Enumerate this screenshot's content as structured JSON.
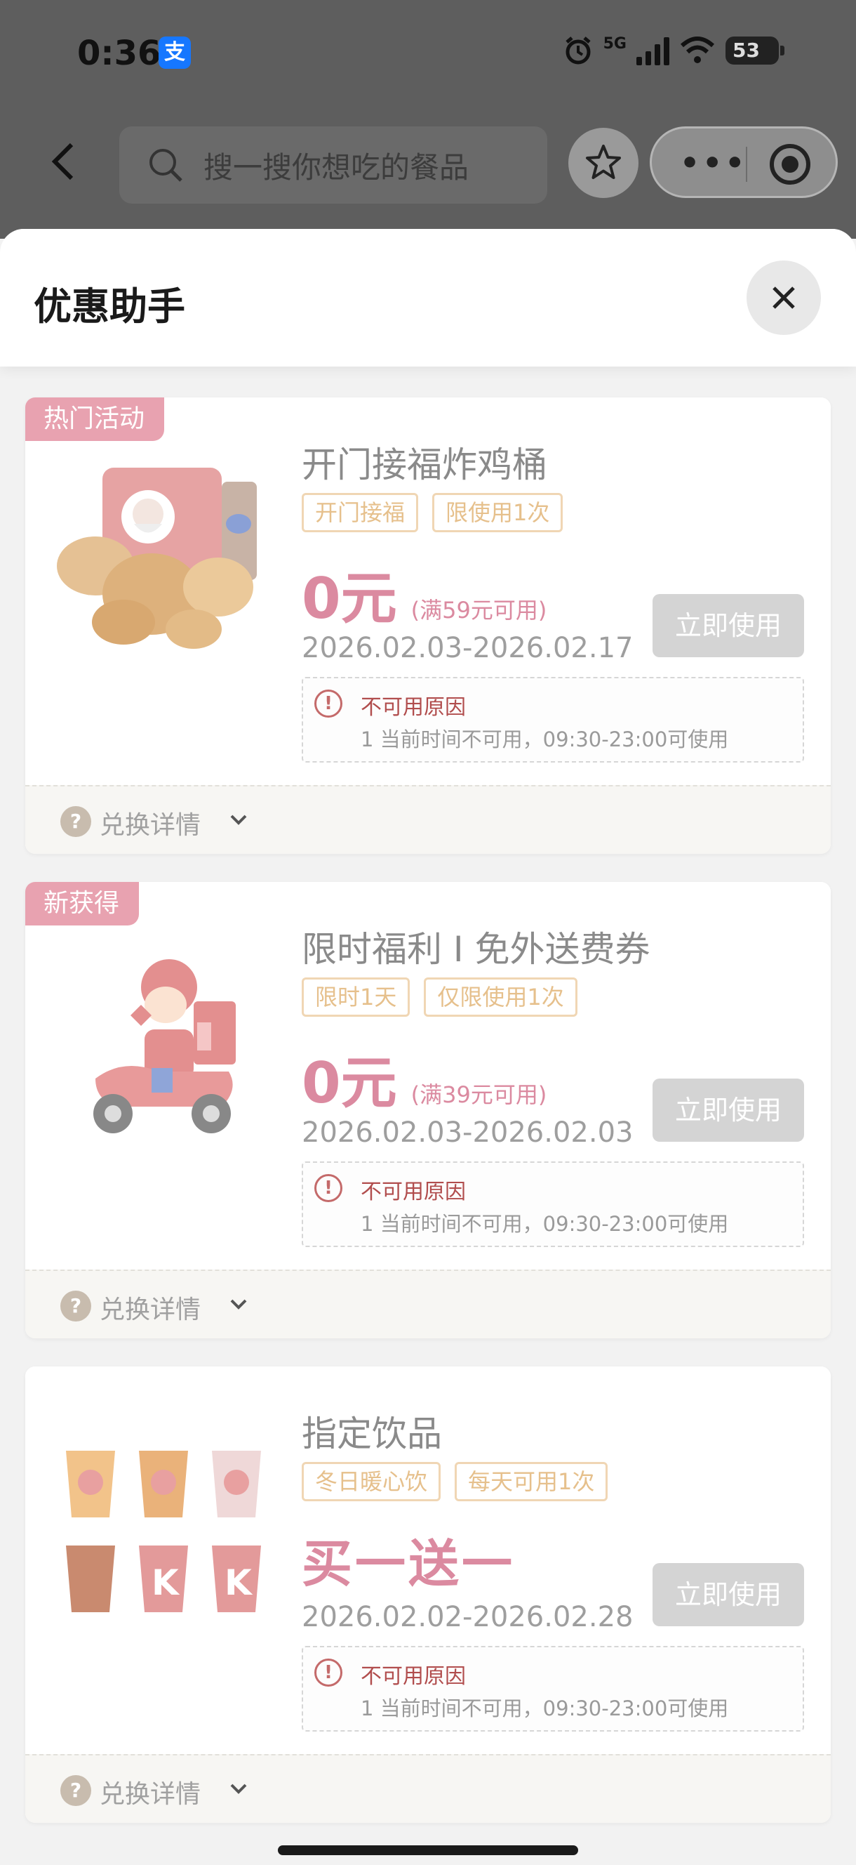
{
  "status": {
    "time": "0:36",
    "alipay_glyph": "支",
    "network": "5G",
    "battery": "53"
  },
  "nav": {
    "search_placeholder": "搜一搜你想吃的餐品"
  },
  "sheet": {
    "title": "优惠助手"
  },
  "coupons": [
    {
      "badge": "热门活动",
      "title": "开门接福炸鸡桶",
      "tags": [
        "开门接福",
        "限使用1次"
      ],
      "price": "0元",
      "condition": "(满59元可用)",
      "date": "2026.02.03-2026.02.17",
      "button": "立即使用",
      "reason_title": "不可用原因",
      "reason_desc": "1 当前时间不可用，09:30-23:00可使用",
      "footer": "兑换详情",
      "image": "fried-chicken-bucket"
    },
    {
      "badge": "新获得",
      "title": "限时福利 I 免外送费券",
      "tags": [
        "限时1天",
        "仅限使用1次"
      ],
      "price": "0元",
      "condition": "(满39元可用)",
      "date": "2026.02.03-2026.02.03",
      "button": "立即使用",
      "reason_title": "不可用原因",
      "reason_desc": "1 当前时间不可用，09:30-23:00可使用",
      "footer": "兑换详情",
      "image": "delivery-scooter-rider"
    },
    {
      "title": "指定饮品",
      "tags": [
        "冬日暖心饮",
        "每天可用1次"
      ],
      "price": "买一送一",
      "date": "2026.02.02-2026.02.28",
      "button": "立即使用",
      "reason_title": "不可用原因",
      "reason_desc": "1 当前时间不可用，09:30-23:00可使用",
      "footer": "兑换详情",
      "image": "kfc-drinks"
    }
  ],
  "colors": {
    "accent": "#db8aa0",
    "badge": "#e8a2b0",
    "tag": "#e6c08c",
    "disabled": "#d4d4d4"
  }
}
